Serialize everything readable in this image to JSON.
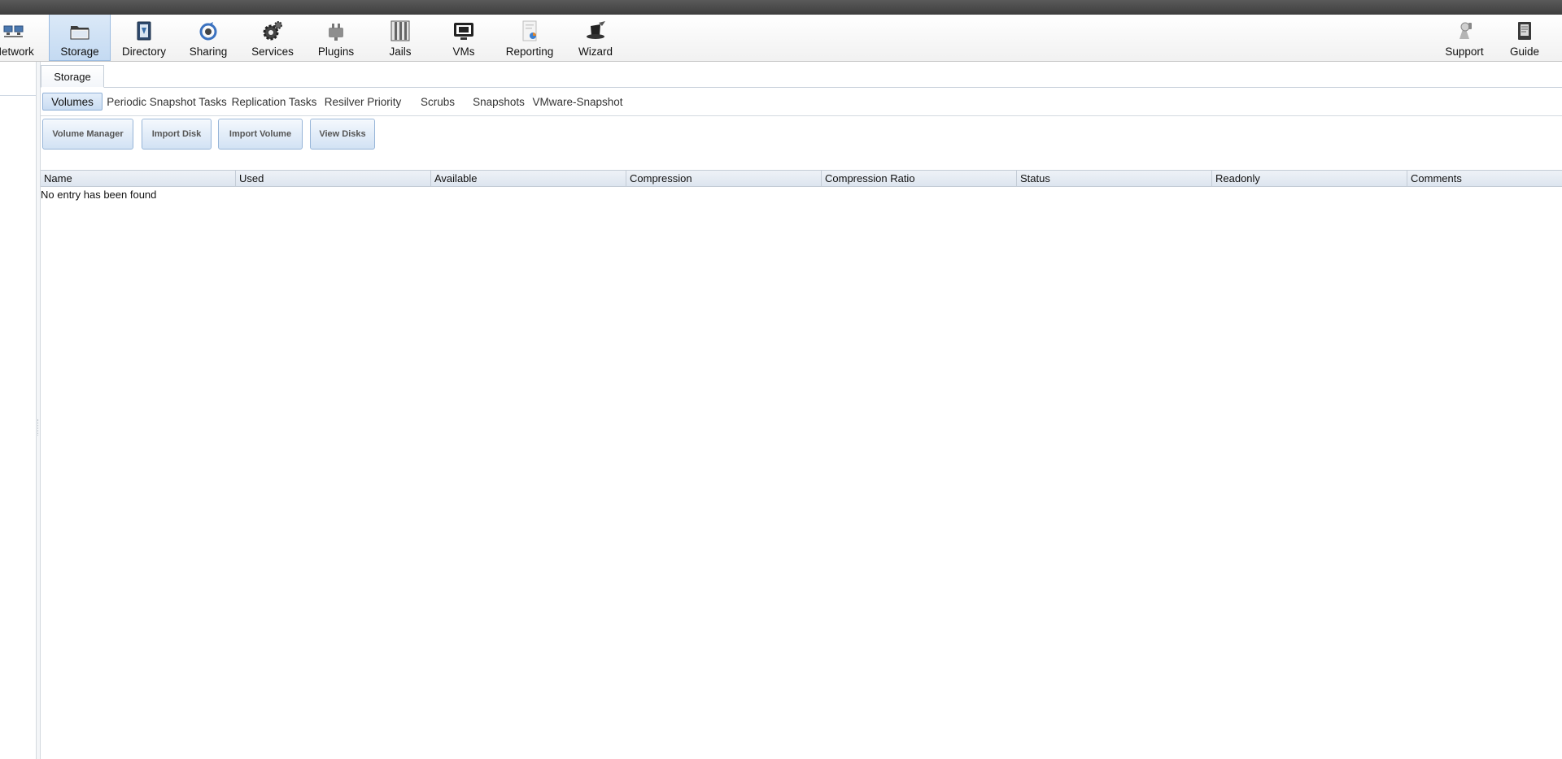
{
  "nav": {
    "items": [
      {
        "label": "Network",
        "icon": "network-icon"
      },
      {
        "label": "Storage",
        "icon": "storage-icon",
        "active": true
      },
      {
        "label": "Directory",
        "icon": "directory-icon"
      },
      {
        "label": "Sharing",
        "icon": "sharing-icon"
      },
      {
        "label": "Services",
        "icon": "services-icon"
      },
      {
        "label": "Plugins",
        "icon": "plugins-icon"
      },
      {
        "label": "Jails",
        "icon": "jails-icon"
      },
      {
        "label": "VMs",
        "icon": "vms-icon"
      },
      {
        "label": "Reporting",
        "icon": "reporting-icon"
      },
      {
        "label": "Wizard",
        "icon": "wizard-icon"
      }
    ],
    "right_items": [
      {
        "label": "Support",
        "icon": "support-icon"
      },
      {
        "label": "Guide",
        "icon": "guide-icon"
      }
    ]
  },
  "outer_tab": {
    "label": "Storage"
  },
  "subtabs": [
    {
      "label": "Volumes",
      "active": true
    },
    {
      "label": "Periodic Snapshot Tasks"
    },
    {
      "label": "Replication Tasks"
    },
    {
      "label": "Resilver Priority"
    },
    {
      "label": "Scrubs"
    },
    {
      "label": "Snapshots"
    },
    {
      "label": "VMware-Snapshot"
    }
  ],
  "buttons": {
    "volume_manager": "Volume Manager",
    "import_disk": "Import Disk",
    "import_volume": "Import Volume",
    "view_disks": "View Disks"
  },
  "grid": {
    "columns": [
      "Name",
      "Used",
      "Available",
      "Compression",
      "Compression Ratio",
      "Status",
      "Readonly",
      "Comments"
    ],
    "empty_message": "No entry has been found"
  },
  "colors": {
    "accent": "#c4daf2",
    "accent_border": "#9bbbe0",
    "topbar": "#4a4a4a"
  }
}
